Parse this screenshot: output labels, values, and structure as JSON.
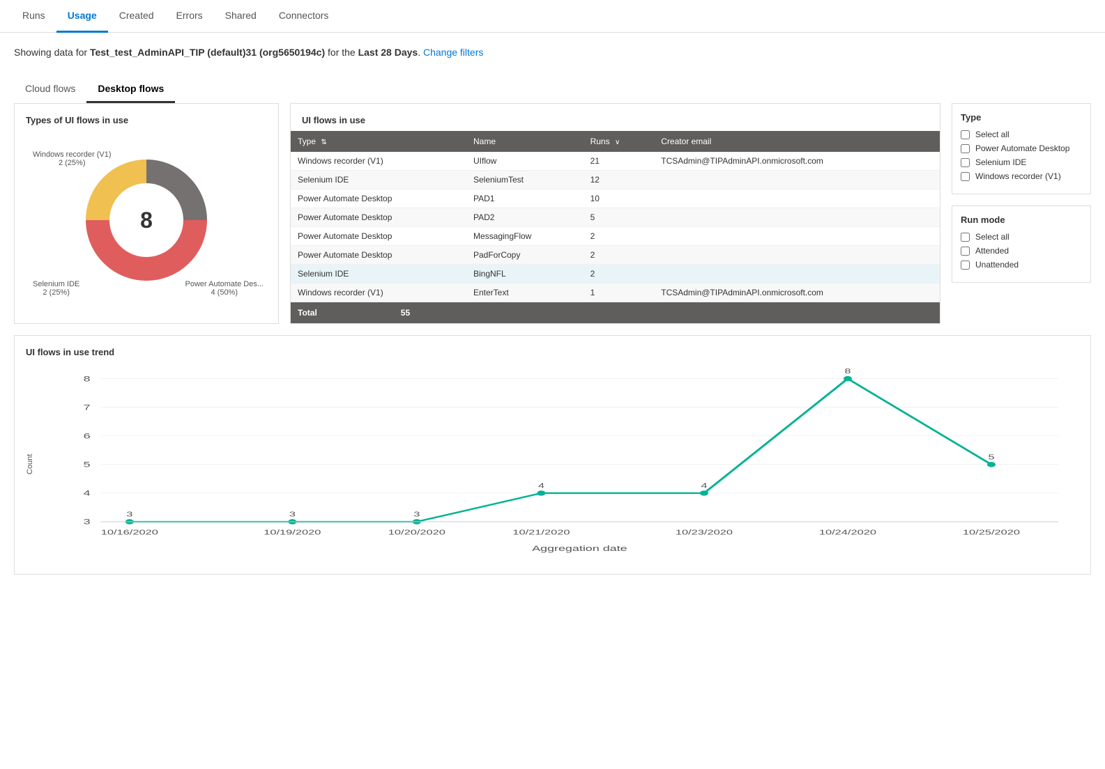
{
  "nav": {
    "tabs": [
      {
        "label": "Runs",
        "active": false
      },
      {
        "label": "Usage",
        "active": true
      },
      {
        "label": "Created",
        "active": false
      },
      {
        "label": "Errors",
        "active": false
      },
      {
        "label": "Shared",
        "active": false
      },
      {
        "label": "Connectors",
        "active": false
      }
    ]
  },
  "header": {
    "prefix": "Showing data for ",
    "org": "Test_test_AdminAPI_TIP (default)31 (org5650194c)",
    "middle": " for the ",
    "period": "Last 28 Days",
    "suffix": ".",
    "change_filters": "Change filters"
  },
  "content_tabs": [
    {
      "label": "Cloud flows",
      "active": false
    },
    {
      "label": "Desktop flows",
      "active": true
    }
  ],
  "donut_panel": {
    "title": "Types of UI flows in use",
    "center_value": "8",
    "segments": [
      {
        "label": "Windows recorder (V1)",
        "value": "2 (25%)",
        "color": "#767171",
        "percent": 25
      },
      {
        "label": "Power Automate Des...",
        "value": "4 (50%)",
        "color": "#e05d5d",
        "percent": 50
      },
      {
        "label": "Selenium IDE",
        "value": "2 (25%)",
        "color": "#f0c050",
        "percent": 25
      }
    ]
  },
  "ui_flows_table": {
    "title": "UI flows in use",
    "columns": [
      {
        "label": "Type",
        "sort": true
      },
      {
        "label": "Name",
        "sort": false
      },
      {
        "label": "Runs",
        "sort": true,
        "desc": true
      },
      {
        "label": "Creator email",
        "sort": false
      }
    ],
    "rows": [
      {
        "type": "Windows recorder (V1)",
        "name": "UIflow",
        "runs": "21",
        "email": "TCSAdmin@TIPAdminAPI.onmicrosoft.com",
        "highlight": false
      },
      {
        "type": "Selenium IDE",
        "name": "SeleniumTest",
        "runs": "12",
        "email": "",
        "highlight": false
      },
      {
        "type": "Power Automate Desktop",
        "name": "PAD1",
        "runs": "10",
        "email": "",
        "highlight": false
      },
      {
        "type": "Power Automate Desktop",
        "name": "PAD2",
        "runs": "5",
        "email": "",
        "highlight": false
      },
      {
        "type": "Power Automate Desktop",
        "name": "MessagingFlow",
        "runs": "2",
        "email": "",
        "highlight": false
      },
      {
        "type": "Power Automate Desktop",
        "name": "PadForCopy",
        "runs": "2",
        "email": "",
        "highlight": false
      },
      {
        "type": "Selenium IDE",
        "name": "BingNFL",
        "runs": "2",
        "email": "",
        "highlight": true
      },
      {
        "type": "Windows recorder (V1)",
        "name": "EnterText",
        "runs": "1",
        "email": "TCSAdmin@TIPAdminAPI.onmicrosoft.com",
        "highlight": false
      }
    ],
    "footer_label": "Total",
    "footer_value": "55"
  },
  "type_filter": {
    "title": "Type",
    "options": [
      {
        "label": "Select all",
        "checked": false
      },
      {
        "label": "Power Automate Desktop",
        "checked": false
      },
      {
        "label": "Selenium IDE",
        "checked": false
      },
      {
        "label": "Windows recorder (V1)",
        "checked": false
      }
    ]
  },
  "run_mode_filter": {
    "title": "Run mode",
    "options": [
      {
        "label": "Select all",
        "checked": false
      },
      {
        "label": "Attended",
        "checked": false
      },
      {
        "label": "Unattended",
        "checked": false
      }
    ]
  },
  "trend_panel": {
    "title": "UI flows in use trend",
    "y_axis_label": "Count",
    "x_axis_label": "Aggregation date",
    "y_max": 8,
    "y_min": 3,
    "data_points": [
      {
        "date": "10/16/2020",
        "value": 3,
        "x_pct": 3
      },
      {
        "date": "10/19/2020",
        "value": 3,
        "x_pct": 20
      },
      {
        "date": "10/20/2020",
        "value": 3,
        "x_pct": 33
      },
      {
        "date": "10/21/2020",
        "value": 4,
        "x_pct": 46
      },
      {
        "date": "10/23/2020",
        "value": 4,
        "x_pct": 63
      },
      {
        "date": "10/24/2020",
        "value": 8,
        "x_pct": 78
      },
      {
        "date": "10/25/2020",
        "value": 5,
        "x_pct": 93
      }
    ],
    "y_ticks": [
      3,
      4,
      5,
      6,
      7,
      8
    ]
  }
}
